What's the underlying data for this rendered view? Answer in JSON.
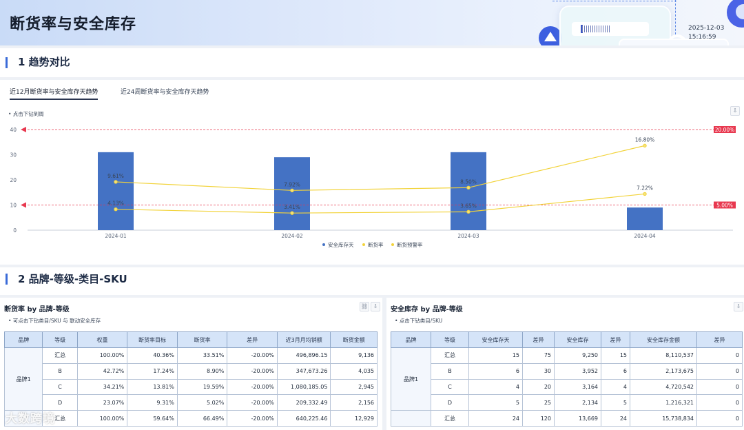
{
  "header": {
    "title": "断货率与安全库存",
    "date": "2025-12-03",
    "time": "15:16:59"
  },
  "section1": {
    "title": "1 趋势对比"
  },
  "section2": {
    "title": "2 品牌-等级-类目-SKU"
  },
  "chart_panel": {
    "tabs": [
      "近12月断货率与安全库存天趋势",
      "近24周断货率与安全库存天趋势"
    ],
    "active_tab": 0,
    "hint": "• 点击下钻到周"
  },
  "chart_data": {
    "type": "bar",
    "categories": [
      "2024-01",
      "2024-02",
      "2024-03",
      "2024-04"
    ],
    "ylim": [
      0,
      40
    ],
    "y_ticks": [
      "0",
      "10",
      "20",
      "30",
      "40"
    ],
    "series": [
      {
        "name": "安全库存天",
        "type": "bar",
        "color": "#4472c4",
        "values": [
          31,
          29,
          31,
          9
        ]
      },
      {
        "name": "断货率",
        "type": "line",
        "color": "#f2d33a",
        "values": [
          19.2,
          15.8,
          16.9,
          33.6
        ],
        "labels": [
          "9.61%",
          "7.92%",
          "8.50%",
          "16.80%"
        ]
      },
      {
        "name": "断货预警率",
        "type": "line",
        "color": "#f2d33a",
        "values": [
          8.3,
          6.8,
          7.3,
          14.4
        ],
        "labels": [
          "4.13%",
          "3.41%",
          "3.65%",
          "7.22%"
        ]
      }
    ],
    "reference_lines": [
      {
        "value": 40,
        "label": "20.00%",
        "color": "#e8384f"
      },
      {
        "value": 10,
        "label": "5.00%",
        "color": "#e8384f"
      }
    ],
    "legend": [
      "安全库存天",
      "断货率",
      "断货预警率"
    ],
    "legend_position": "bottom"
  },
  "left_table": {
    "title": "断货率 by 品牌-等级",
    "hint": "• 可点击下钻类目/SKU 与 联动安全库存",
    "headers": [
      "品牌",
      "等级",
      "权重",
      "断货率目标",
      "断货率",
      "差异",
      "近3月月均销额",
      "断货金额"
    ],
    "brand": "品牌1",
    "rows": [
      [
        "汇总",
        "100.00%",
        "40.36%",
        "33.51%",
        "-20.00%",
        "496,896.15",
        "9,136"
      ],
      [
        "B",
        "42.72%",
        "17.24%",
        "8.90%",
        "-20.00%",
        "347,673.26",
        "4,035"
      ],
      [
        "C",
        "34.21%",
        "13.81%",
        "19.59%",
        "-20.00%",
        "1,080,185.05",
        "2,945"
      ],
      [
        "D",
        "23.07%",
        "9.31%",
        "5.02%",
        "-20.00%",
        "209,332.49",
        "2,156"
      ],
      [
        "汇总",
        "100.00%",
        "59.64%",
        "66.49%",
        "-20.00%",
        "640,225.46",
        "12,929"
      ]
    ]
  },
  "right_table": {
    "title": "安全库存 by 品牌-等级",
    "hint": "• 点击下钻类目/SKU",
    "headers": [
      "品牌",
      "等级",
      "安全库存天",
      "差异",
      "安全库存",
      "差异",
      "安全库存金额",
      "差异"
    ],
    "brand": "品牌1",
    "rows": [
      [
        "汇总",
        "15",
        "75",
        "9,250",
        "15",
        "8,110,537",
        "0"
      ],
      [
        "B",
        "6",
        "30",
        "3,952",
        "6",
        "2,173,675",
        "0"
      ],
      [
        "C",
        "4",
        "20",
        "3,164",
        "4",
        "4,720,542",
        "0"
      ],
      [
        "D",
        "5",
        "25",
        "2,134",
        "5",
        "1,216,321",
        "0"
      ],
      [
        "汇总",
        "24",
        "120",
        "13,669",
        "24",
        "15,738,834",
        "0"
      ]
    ]
  },
  "watermark": "大数跨境",
  "icons": {
    "share": "link-icon",
    "download": "download-icon",
    "chart_download": "download-icon"
  }
}
